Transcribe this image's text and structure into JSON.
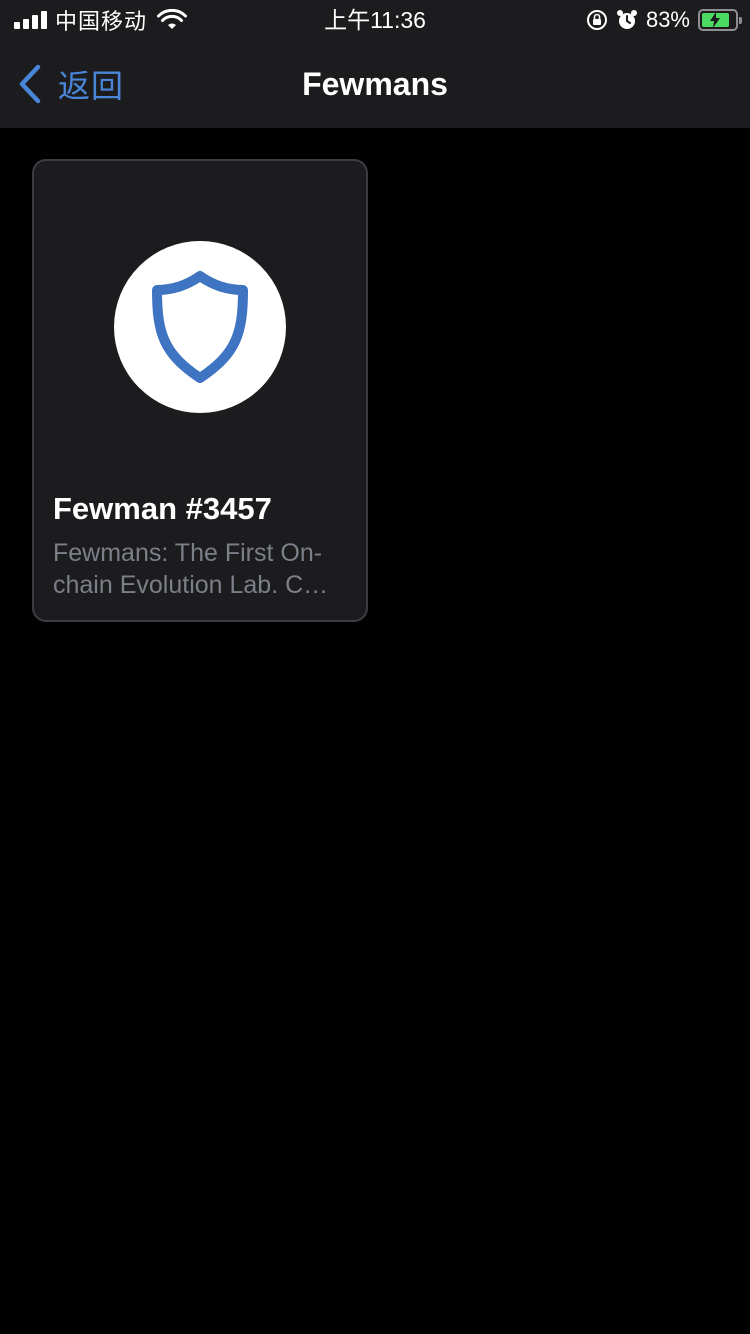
{
  "status_bar": {
    "carrier": "中国移动",
    "time": "上午11:36",
    "battery_percent": "83%",
    "icons": [
      "signal-icon",
      "wifi-icon",
      "orientation-lock-icon",
      "alarm-icon",
      "battery-charging-icon"
    ]
  },
  "nav": {
    "back_label": "返回",
    "title": "Fewmans"
  },
  "collection": {
    "items": [
      {
        "title": "Fewman #3457",
        "description": "Fewmans: The First On-chain Evolution Lab. C…",
        "logo_icon": "trust-wallet-shield-icon"
      }
    ]
  },
  "colors": {
    "accent": "#4a86d8",
    "shield_blue": "#3f74c2",
    "card_background": "#1c1c1e",
    "battery_green": "#4cd964"
  }
}
